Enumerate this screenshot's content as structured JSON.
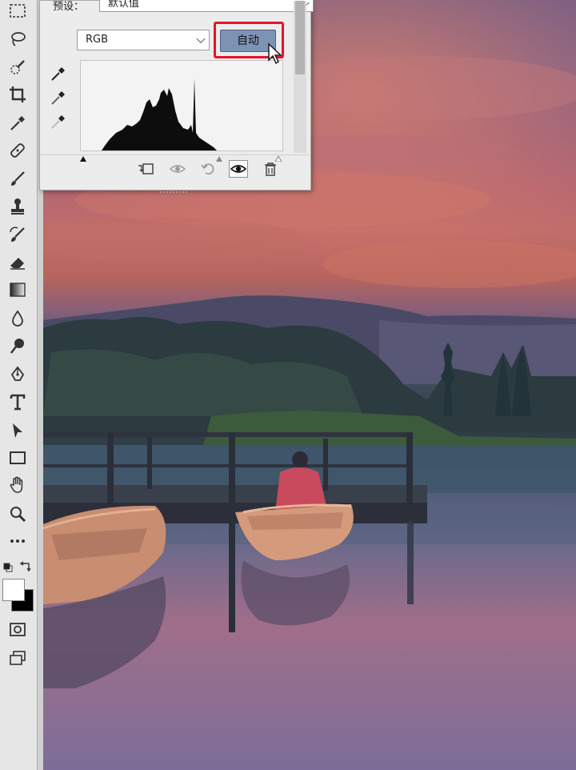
{
  "panel": {
    "preset_label": "预设：",
    "preset_value": "默认值",
    "channel_value": "RGB",
    "auto_label": "自动"
  },
  "icons": {
    "toolbar": [
      "marquee-icon",
      "lasso-icon",
      "quick-select-icon",
      "crop-icon",
      "eyedropper-icon",
      "healing-icon",
      "brush-icon",
      "stamp-icon",
      "history-brush-icon",
      "eraser-icon",
      "gradient-icon",
      "blur-icon",
      "dodge-icon",
      "pen-icon",
      "type-icon",
      "path-select-icon",
      "rectangle-icon",
      "hand-icon",
      "zoom-icon",
      "more-icon"
    ],
    "footer": [
      "clip-to-layer-icon",
      "view-previous-icon",
      "reset-icon",
      "visibility-eye-icon",
      "delete-icon"
    ]
  },
  "colors": {
    "highlight": "#e5142a",
    "auto_button": "#7d93b3",
    "toolbar_bg": "#e6e6e6",
    "foreground": "#ffffff",
    "background": "#000000"
  }
}
